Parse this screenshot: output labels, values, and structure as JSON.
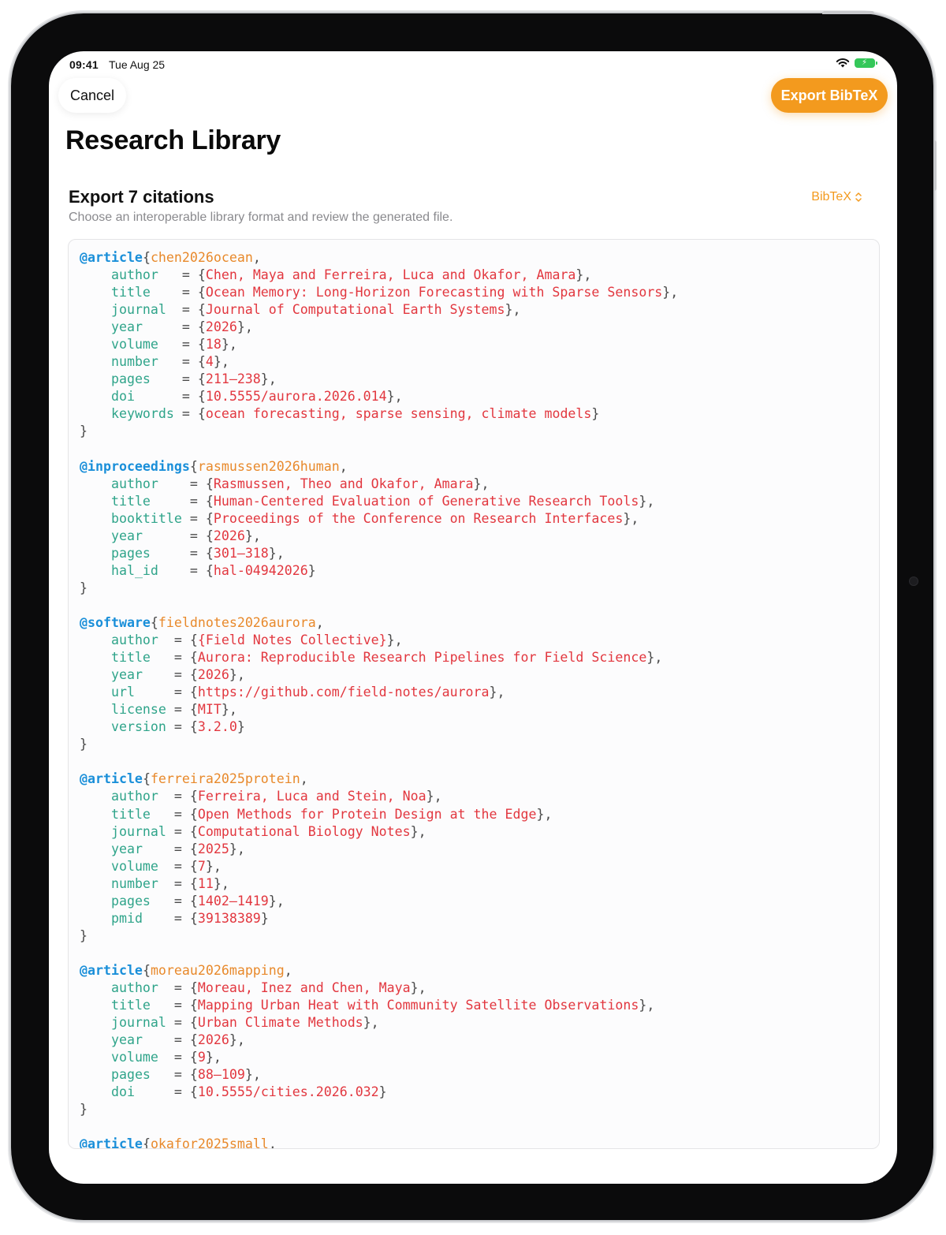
{
  "status_bar": {
    "time": "09:41",
    "date": "Tue Aug 25"
  },
  "nav": {
    "cancel_label": "Cancel",
    "export_label": "Export BibTeX"
  },
  "page_title": "Research Library",
  "section": {
    "title": "Export 7 citations",
    "subtitle": "Choose an interoperable library format and review the generated file.",
    "format": "BibTeX"
  },
  "colors": {
    "accent": "#f39a1e",
    "keyword": "#1a8fd9",
    "citekey": "#e8892b",
    "field": "#2fa48a",
    "value": "#e2373f"
  },
  "icons": {
    "wifi": "wifi-icon",
    "battery": "battery-charging-icon",
    "format_chevron": "chevron-up-down-icon"
  },
  "entries": [
    {
      "type": "@article",
      "key": "chen2026ocean",
      "pad": 8,
      "fields": [
        {
          "name": "author",
          "value": "Chen, Maya and Ferreira, Luca and Okafor, Amara"
        },
        {
          "name": "title",
          "value": "Ocean Memory: Long-Horizon Forecasting with Sparse Sensors"
        },
        {
          "name": "journal",
          "value": "Journal of Computational Earth Systems"
        },
        {
          "name": "year",
          "value": "2026"
        },
        {
          "name": "volume",
          "value": "18"
        },
        {
          "name": "number",
          "value": "4"
        },
        {
          "name": "pages",
          "value": "211–238"
        },
        {
          "name": "doi",
          "value": "10.5555/aurora.2026.014"
        },
        {
          "name": "keywords",
          "value": "ocean forecasting, sparse sensing, climate models"
        }
      ]
    },
    {
      "type": "@inproceedings",
      "key": "rasmussen2026human",
      "pad": 9,
      "fields": [
        {
          "name": "author",
          "value": "Rasmussen, Theo and Okafor, Amara"
        },
        {
          "name": "title",
          "value": "Human-Centered Evaluation of Generative Research Tools"
        },
        {
          "name": "booktitle",
          "value": "Proceedings of the Conference on Research Interfaces"
        },
        {
          "name": "year",
          "value": "2026"
        },
        {
          "name": "pages",
          "value": "301–318"
        },
        {
          "name": "hal_id",
          "value": "hal-04942026"
        }
      ]
    },
    {
      "type": "@software",
      "key": "fieldnotes2026aurora",
      "pad": 7,
      "fields": [
        {
          "name": "author",
          "value": "{Field Notes Collective}"
        },
        {
          "name": "title",
          "value": "Aurora: Reproducible Research Pipelines for Field Science"
        },
        {
          "name": "year",
          "value": "2026"
        },
        {
          "name": "url",
          "value": "https://github.com/field-notes/aurora"
        },
        {
          "name": "license",
          "value": "MIT"
        },
        {
          "name": "version",
          "value": "3.2.0"
        }
      ]
    },
    {
      "type": "@article",
      "key": "ferreira2025protein",
      "pad": 7,
      "fields": [
        {
          "name": "author",
          "value": "Ferreira, Luca and Stein, Noa"
        },
        {
          "name": "title",
          "value": "Open Methods for Protein Design at the Edge"
        },
        {
          "name": "journal",
          "value": "Computational Biology Notes"
        },
        {
          "name": "year",
          "value": "2025"
        },
        {
          "name": "volume",
          "value": "7"
        },
        {
          "name": "number",
          "value": "11"
        },
        {
          "name": "pages",
          "value": "1402–1419"
        },
        {
          "name": "pmid",
          "value": "39138389"
        }
      ]
    },
    {
      "type": "@article",
      "key": "moreau2026mapping",
      "pad": 7,
      "fields": [
        {
          "name": "author",
          "value": "Moreau, Inez and Chen, Maya"
        },
        {
          "name": "title",
          "value": "Mapping Urban Heat with Community Satellite Observations"
        },
        {
          "name": "journal",
          "value": "Urban Climate Methods"
        },
        {
          "name": "year",
          "value": "2026"
        },
        {
          "name": "volume",
          "value": "9"
        },
        {
          "name": "pages",
          "value": "88–109"
        },
        {
          "name": "doi",
          "value": "10.5555/cities.2026.032"
        }
      ]
    },
    {
      "type": "@article",
      "key": "okafor2025small",
      "pad": 7,
      "fields": []
    }
  ]
}
